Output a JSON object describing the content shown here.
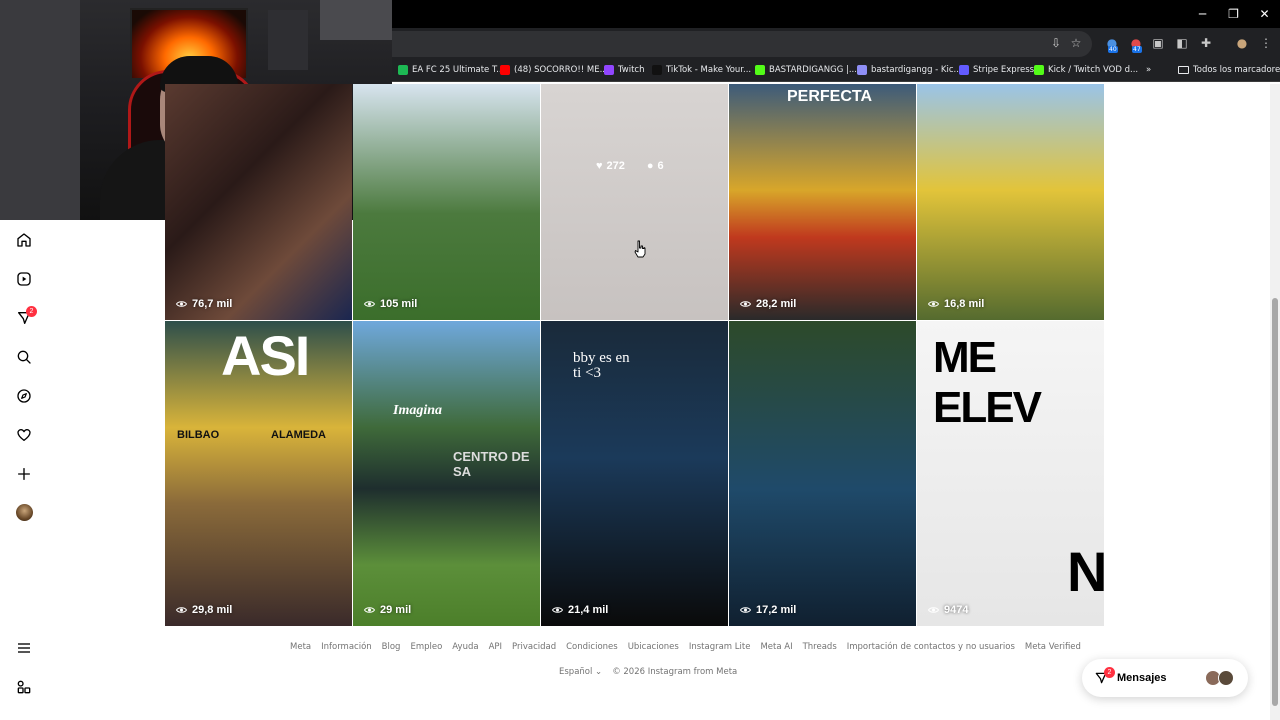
{
  "browser": {
    "window_controls": [
      "─",
      "❐",
      "✕"
    ],
    "bookmarks": [
      {
        "label": "EA FC 25 Ultimate T...",
        "color": "#1db954"
      },
      {
        "label": "(48) SOCORRO!! ME...",
        "color": "#ff0000"
      },
      {
        "label": "Twitch",
        "color": "#9146ff"
      },
      {
        "label": "TikTok - Make Your...",
        "color": "#111111"
      },
      {
        "label": "BASTARDIGANGG |...",
        "color": "#53fc18"
      },
      {
        "label": "bastardigangg - Kic...",
        "color": "#8e8ef5"
      },
      {
        "label": "Stripe Express",
        "color": "#635bff"
      },
      {
        "label": "Kick / Twitch VOD d...",
        "color": "#53fc18"
      }
    ],
    "more_bookmarks": "»",
    "all_bookmarks": "Todos los marcadores",
    "ext_badges": [
      "40",
      "47"
    ]
  },
  "sidebar": {
    "notifications_badge": "2"
  },
  "grid": {
    "tiles": [
      {
        "views": "76,7 mil",
        "bg": "linear-gradient(135deg,#5a3a30 0%,#2a1a18 40%,#6e4a3a 70%,#1a2650 100%)"
      },
      {
        "views": "105 mil",
        "bg": "linear-gradient(180deg,#d7e4ef 0%,#4c7a3e 55%,#3b6e2b 100%)"
      },
      {
        "views": "",
        "bg": "linear-gradient(180deg,#d8d4d2 0%,#c7c2c0 100%)"
      },
      {
        "views": "28,2 mil",
        "bg": "linear-gradient(180deg,#3d5b7a 0%,#d8a62a 45%,#c0391e 65%,#2a2a2a 100%)",
        "text": "PERFECTA"
      },
      {
        "views": "16,8 mil",
        "bg": "linear-gradient(180deg,#9ac4e8 0%,#e2c43a 45%,#556b2f 100%)"
      },
      {
        "views": "29,8 mil",
        "bg": "linear-gradient(180deg,#2e4f4b 0%,#d9b43a 35%,#8a6a3a 60%,#3a2a2a 100%)",
        "text": "ASI",
        "sign1": "BILBAO",
        "sign2": "ALAMEDA"
      },
      {
        "views": "29 mil",
        "bg": "linear-gradient(180deg,#6fa8dc 0%,#3f6a3a 35%,#1e2e2e 55%,#5c8f3a 80%,#4c7f2a 100%)",
        "text": "Imagina",
        "sign1": "CENTRO DE SA"
      },
      {
        "views": "21,4 mil",
        "bg": "linear-gradient(180deg,#1a2a3a 0%,#1b3a5a 45%,#0a0a0a 100%)",
        "text": "bby es en ti <3"
      },
      {
        "views": "17,2 mil",
        "bg": "linear-gradient(180deg,#2d4a2a 0%,#1f4a6a 55%,#102030 100%)"
      },
      {
        "views": "9474",
        "bg": "linear-gradient(180deg,#f5f5f5 0%,#e6e6e6 100%)",
        "text": "ME ELEV",
        "text2": "NO"
      }
    ],
    "hover": {
      "likes": "272",
      "comments": "6"
    }
  },
  "footer": {
    "links": [
      "Meta",
      "Información",
      "Blog",
      "Empleo",
      "Ayuda",
      "API",
      "Privacidad",
      "Condiciones",
      "Ubicaciones",
      "Instagram Lite",
      "Meta AI",
      "Threads",
      "Importación de contactos y no usuarios",
      "Meta Verified"
    ],
    "language": "Español",
    "copyright": "© 2026 Instagram from Meta"
  },
  "messages": {
    "label": "Mensajes",
    "badge": "2"
  }
}
